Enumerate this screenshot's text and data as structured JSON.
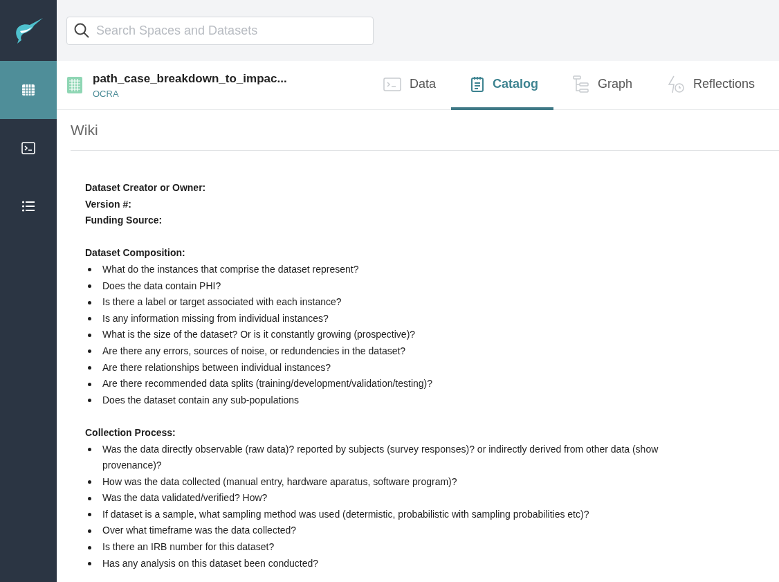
{
  "sidebar": {
    "items": [
      {
        "kind": "grid",
        "selected": true
      },
      {
        "kind": "terminal",
        "selected": false
      },
      {
        "kind": "list",
        "selected": false
      }
    ]
  },
  "search": {
    "placeholder": "Search Spaces and Datasets"
  },
  "dataset": {
    "name": "path_case_breakdown_to_impac...",
    "space": "OCRA"
  },
  "tabs": [
    {
      "kind": "terminal",
      "label": "Data",
      "selected": false
    },
    {
      "kind": "catalog",
      "label": "Catalog",
      "selected": true
    },
    {
      "kind": "graph",
      "label": "Graph",
      "selected": false
    },
    {
      "kind": "reflections",
      "label": "Reflections",
      "selected": false
    }
  ],
  "wiki": {
    "title": "Wiki",
    "fields": [
      "Dataset Creator or Owner:",
      "Version #:",
      "Funding Source:"
    ],
    "sections": [
      {
        "heading": "Dataset Composition:",
        "items": [
          {
            "lines": [
              "What do the instances that comprise the dataset represent?"
            ]
          },
          {
            "lines": [
              "Does the data contain PHI?"
            ]
          },
          {
            "lines": [
              "Is there a label or target associated with each instance?"
            ]
          },
          {
            "lines": [
              "Is any information missing from individual instances?"
            ]
          },
          {
            "lines": [
              "What is the size of the dataset? Or is it constantly growing (prospective)?"
            ]
          },
          {
            "lines": [
              "Are there any errors, sources of noise, or redundencies in the dataset?"
            ]
          },
          {
            "lines": [
              "Are there relationships between individual instances?"
            ]
          },
          {
            "lines": [
              "Are there recommended data splits (training/development/validation/testing)?"
            ]
          },
          {
            "lines": [
              "Does the dataset contain any sub-populations"
            ]
          }
        ]
      },
      {
        "heading": "Collection Process:",
        "items": [
          {
            "lines": [
              "Was the data directly observable (raw data)? reported by subjects (survey responses)? or indirectly derived from other data (show",
              "provenance)?"
            ]
          },
          {
            "lines": [
              "How was the data collected (manual entry, hardware aparatus, software program)?"
            ]
          },
          {
            "lines": [
              "Was the data validated/verified? How?"
            ]
          },
          {
            "lines": [
              "If dataset is a sample, what sampling method was used (determistic, probabilistic with sampling probabilities etc)?"
            ]
          },
          {
            "lines": [
              "Over what timeframe was the data collected?"
            ]
          },
          {
            "lines": [
              "Is there an IRB number for this dataset?"
            ]
          },
          {
            "lines": [
              "Has any analysis on this dataset been conducted?"
            ]
          }
        ]
      }
    ]
  }
}
